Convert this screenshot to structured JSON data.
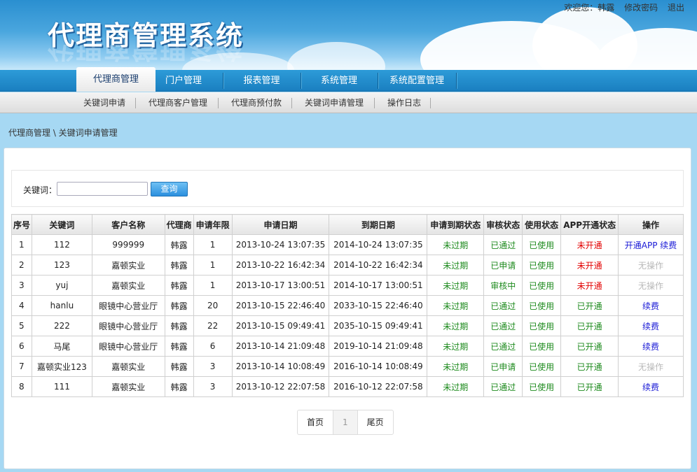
{
  "header": {
    "app_title": "代理商管理系统",
    "welcome": "欢迎您：韩露",
    "change_password": "修改密码",
    "logout": "退出"
  },
  "main_nav": [
    {
      "label": "代理商管理",
      "active": true
    },
    {
      "label": "门户管理"
    },
    {
      "label": "报表管理"
    },
    {
      "label": "系统管理"
    },
    {
      "label": "系统配置管理"
    }
  ],
  "sub_nav": [
    "关键词申请",
    "代理商客户管理",
    "代理商预付款",
    "关键词申请管理",
    "操作日志"
  ],
  "breadcrumb": "代理商管理 \\ 关键词申请管理",
  "search": {
    "label": "关键词：",
    "value": "",
    "placeholder": "",
    "button": "查询"
  },
  "table": {
    "headers": [
      "序号",
      "关键词",
      "客户名称",
      "代理商",
      "申请年限",
      "申请日期",
      "到期日期",
      "申请到期状态",
      "审核状态",
      "使用状态",
      "APP开通状态",
      "操作"
    ],
    "rows": [
      {
        "no": "1",
        "keyword": "112",
        "client": "999999",
        "agent": "韩露",
        "years": "1",
        "apply": "2013-10-24 13:07:35",
        "expire": "2014-10-24 13:07:35",
        "exp_status": "未过期",
        "audit": "已通过",
        "use": "已使用",
        "app": "未开通",
        "op1": "开通APP",
        "op2": "续费"
      },
      {
        "no": "2",
        "keyword": "123",
        "client": "嘉顿实业",
        "agent": "韩露",
        "years": "1",
        "apply": "2013-10-22 16:42:34",
        "expire": "2014-10-22 16:42:34",
        "exp_status": "未过期",
        "audit": "已申请",
        "use": "已使用",
        "app": "未开通",
        "op1": "无操作"
      },
      {
        "no": "3",
        "keyword": "yuj",
        "client": "嘉顿实业",
        "agent": "韩露",
        "years": "1",
        "apply": "2013-10-17 13:00:51",
        "expire": "2014-10-17 13:00:51",
        "exp_status": "未过期",
        "audit": "审核中",
        "use": "已使用",
        "app": "未开通",
        "op1": "无操作"
      },
      {
        "no": "4",
        "keyword": "hanlu",
        "client": "眼镜中心营业厅",
        "agent": "韩露",
        "years": "20",
        "apply": "2013-10-15 22:46:40",
        "expire": "2033-10-15 22:46:40",
        "exp_status": "未过期",
        "audit": "已通过",
        "use": "已使用",
        "app": "已开通",
        "op1": "续费"
      },
      {
        "no": "5",
        "keyword": "222",
        "client": "眼镜中心营业厅",
        "agent": "韩露",
        "years": "22",
        "apply": "2013-10-15 09:49:41",
        "expire": "2035-10-15 09:49:41",
        "exp_status": "未过期",
        "audit": "已通过",
        "use": "已使用",
        "app": "已开通",
        "op1": "续费"
      },
      {
        "no": "6",
        "keyword": "马尾",
        "client": "眼镜中心营业厅",
        "agent": "韩露",
        "years": "6",
        "apply": "2013-10-14 21:09:48",
        "expire": "2019-10-14 21:09:48",
        "exp_status": "未过期",
        "audit": "已通过",
        "use": "已使用",
        "app": "已开通",
        "op1": "续费"
      },
      {
        "no": "7",
        "keyword": "嘉顿实业123",
        "client": "嘉顿实业",
        "agent": "韩露",
        "years": "3",
        "apply": "2013-10-14 10:08:49",
        "expire": "2016-10-14 10:08:49",
        "exp_status": "未过期",
        "audit": "已申请",
        "use": "已使用",
        "app": "已开通",
        "op1": "无操作"
      },
      {
        "no": "8",
        "keyword": "111",
        "client": "嘉顿实业",
        "agent": "韩露",
        "years": "3",
        "apply": "2013-10-12 22:07:58",
        "expire": "2016-10-12 22:07:58",
        "exp_status": "未过期",
        "audit": "已通过",
        "use": "已使用",
        "app": "已开通",
        "op1": "续费"
      }
    ]
  },
  "pager": {
    "first": "首页",
    "current": "1",
    "last": "尾页"
  },
  "colors": {
    "ok": "#1d8a1d",
    "bad": "#e20000",
    "disabled": "#b8b8b8",
    "link": "#1a1ad6"
  }
}
